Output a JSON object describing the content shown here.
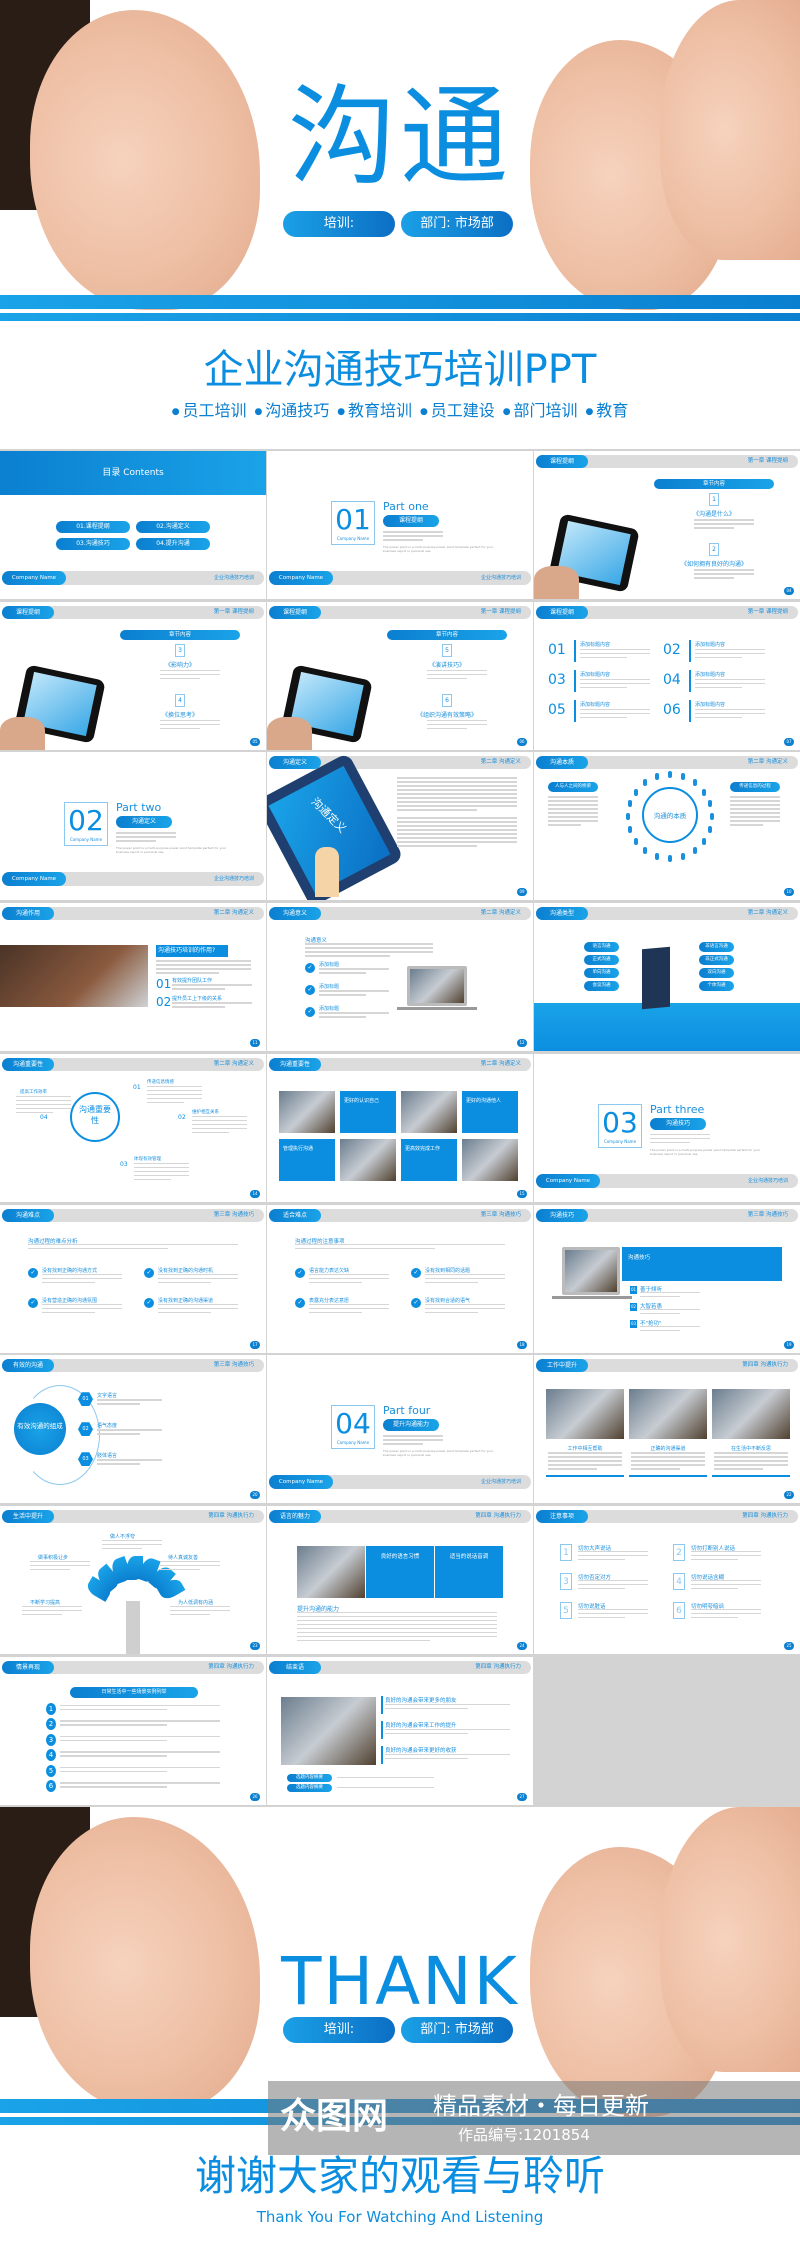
{
  "cover": {
    "title": "沟通",
    "pill_training": "培训:",
    "pill_dept": "部门: 市场部",
    "subtitle": "企业沟通技巧培训PPT",
    "tags": [
      "员工培训",
      "沟通技巧",
      "教育培训",
      "员工建设",
      "部门培训",
      "教育"
    ]
  },
  "colors": {
    "accent": "#0b8ee0",
    "accent_dark": "#0b7fd0",
    "grid_bg": "#d3d3d3"
  },
  "slides": [
    {
      "type": "contents",
      "title": "目录 Contents",
      "items": [
        "01.课程提纲",
        "02.沟通定义",
        "03.沟通技巧",
        "04.提升沟通"
      ],
      "company": "Company Name",
      "footer": "企业沟通技巧培训"
    },
    {
      "type": "part",
      "num": "01",
      "part": "Part one",
      "label": "课程提纲",
      "company": "Company Name",
      "footer": "企业沟通技巧培训",
      "text": "The power point is a multi-purpose power point template perfect for your business report or personal use."
    },
    {
      "type": "chapter",
      "tag": "课程提纲",
      "sec": "第一章 课程提纲",
      "head": "章节内容",
      "items": [
        {
          "n": "1",
          "t": "《沟通是什么》"
        },
        {
          "n": "2",
          "t": "《如何拥有良好的沟通》"
        }
      ],
      "page": "04"
    },
    {
      "type": "chapter",
      "tag": "课程提纲",
      "sec": "第一章 课程提纲",
      "head": "章节内容",
      "items": [
        {
          "n": "3",
          "t": "《影响力》"
        },
        {
          "n": "4",
          "t": "《换位思考》"
        }
      ],
      "page": "05"
    },
    {
      "type": "chapter",
      "tag": "课程提纲",
      "sec": "第一章 课程提纲",
      "head": "章节内容",
      "items": [
        {
          "n": "5",
          "t": "《演讲技巧》"
        },
        {
          "n": "6",
          "t": "《组织沟通有效策略》"
        }
      ],
      "page": "06"
    },
    {
      "type": "sixlist",
      "tag": "课程提纲",
      "sec": "第一章 课程提纲",
      "items": [
        "01",
        "02",
        "03",
        "04",
        "05",
        "06"
      ],
      "label": "添加标题内容",
      "page": "07"
    },
    {
      "type": "part",
      "num": "02",
      "part": "Part two",
      "label": "沟通定义",
      "company": "Company Name",
      "footer": "企业沟通技巧培训",
      "text": "The power point is a multi-purpose power point template perfect for your business report or personal use."
    },
    {
      "type": "tabletdef",
      "tag": "沟通定义",
      "sec": "第二章 沟通定义",
      "screen": "沟通定义",
      "page": "09"
    },
    {
      "type": "essence",
      "tag": "沟通本质",
      "sec": "第二章 沟通定义",
      "center": "沟通的本质",
      "left": "人与人之间的桥梁",
      "right": "传递信息的过程",
      "page": "10"
    },
    {
      "type": "role",
      "tag": "沟通作用",
      "sec": "第二章 沟通定义",
      "head": "沟通技巧培训的作用?",
      "items": [
        {
          "n": "01",
          "t": "有效提升团队工作"
        },
        {
          "n": "02",
          "t": "提升员工上下级的关系"
        }
      ],
      "page": "11"
    },
    {
      "type": "meaning",
      "tag": "沟通意义",
      "sec": "第二章 沟通定义",
      "head": "沟通意义",
      "items": [
        "添加标题",
        "添加标题",
        "添加标题"
      ],
      "page": "12"
    },
    {
      "type": "kinds",
      "tag": "沟通类型",
      "sec": "第二章 沟通定义",
      "left": [
        "语言沟通",
        "正式沟通",
        "单向沟通",
        "会议沟通"
      ],
      "right": [
        "非语言沟通",
        "非正式沟通",
        "双向沟通",
        "个体沟通"
      ],
      "page": "13"
    },
    {
      "type": "importance",
      "tag": "沟通重要性",
      "sec": "第二章 沟通定义",
      "center": "沟通重要性",
      "items": [
        {
          "n": "01",
          "t": "传递信息情感"
        },
        {
          "n": "02",
          "t": "维护相互关系"
        },
        {
          "n": "03",
          "t": "体现有效管理"
        },
        {
          "n": "04",
          "t": "提高工作效率"
        }
      ],
      "page": "14"
    },
    {
      "type": "photogrid",
      "tag": "沟通重要性",
      "sec": "第二章 沟通定义",
      "items": [
        "更好的认识自己",
        "更好的沟通他人",
        "管理执行沟通",
        "更高效完成工作"
      ],
      "page": "15"
    },
    {
      "type": "part",
      "num": "03",
      "part": "Part three",
      "label": "沟通技巧",
      "company": "Company Name",
      "footer": "企业沟通技巧培训",
      "text": "The power point is a multi-purpose power point template perfect for your business report or personal use."
    },
    {
      "type": "checks",
      "tag": "沟通难点",
      "sec": "第三章 沟通技巧",
      "head": "沟通过程的难点分析",
      "items": [
        "没有找到正确的沟通方式",
        "没有找到正确的沟通时机",
        "没有营造正确的沟通氛围",
        "没有找到正确的沟通渠道"
      ],
      "page": "17"
    },
    {
      "type": "checks",
      "tag": "适合难点",
      "sec": "第三章 沟通技巧",
      "head": "沟通过程的注意事项",
      "items": [
        "语言能力表达欠缺",
        "没有找到相同的话题",
        "表露充分表达意愿",
        "没有找到合适的语气"
      ],
      "page": "18"
    },
    {
      "type": "skills",
      "tag": "沟通技巧",
      "sec": "第三章 沟通技巧",
      "head": "沟通技巧",
      "items": [
        {
          "n": "01",
          "t": "善于倾听"
        },
        {
          "n": "02",
          "t": "大智若愚"
        },
        {
          "n": "03",
          "t": "不\"抢功\""
        }
      ],
      "page": "19"
    },
    {
      "type": "effective",
      "tag": "有效的沟通",
      "sec": "第三章 沟通技巧",
      "center": "有效沟通的组成",
      "items": [
        {
          "n": "01",
          "t": "文字语言"
        },
        {
          "n": "02",
          "t": "语气态度"
        },
        {
          "n": "03",
          "t": "肢体语言"
        }
      ],
      "page": "20"
    },
    {
      "type": "part",
      "num": "04",
      "part": "Part four",
      "label": "提升沟通能力",
      "company": "Company Name",
      "footer": "企业沟通技巧培训",
      "text": "The power point is a multi-purpose power point template perfect for your business report or personal use."
    },
    {
      "type": "threephotos",
      "tag": "工作中提升",
      "sec": "第四章 沟通执行力",
      "items": [
        "工作中相互帮助",
        "正确的沟通渠道",
        "在生活中不断反思"
      ],
      "page": "22"
    },
    {
      "type": "tree",
      "tag": "生活中提升",
      "sec": "第四章 沟通执行力",
      "items": [
        "做人不浮夸",
        "做事积极让步",
        "待人真诚友善",
        "不断学习提高",
        "为人低调有内涵"
      ],
      "page": "23"
    },
    {
      "type": "language",
      "tag": "语言的魅力",
      "sec": "第四章 沟通执行力",
      "boxes": [
        "良好的语言习惯",
        "适当的说话音调"
      ],
      "head": "提升沟通的能力",
      "page": "24"
    },
    {
      "type": "notes",
      "tag": "注意事项",
      "sec": "第四章 沟通执行力",
      "items": [
        {
          "n": "1",
          "t": "切勿大声说话"
        },
        {
          "n": "2",
          "t": "切勿打断别人说话"
        },
        {
          "n": "3",
          "t": "切勿否定对方"
        },
        {
          "n": "4",
          "t": "切勿说话含糊"
        },
        {
          "n": "5",
          "t": "切勿说脏话"
        },
        {
          "n": "6",
          "t": "切勿明夸暗讽"
        }
      ],
      "page": "25"
    },
    {
      "type": "scenes",
      "tag": "情景再现",
      "sec": "第四章 沟通执行力",
      "head": "日常生活中一些场景实例列举",
      "items": [
        "1",
        "2",
        "3",
        "4",
        "5",
        "6"
      ],
      "page": "26"
    },
    {
      "type": "ending",
      "tag": "结束语",
      "sec": "第四章 沟通执行力",
      "items": [
        "良好的沟通会带来更多的朋友",
        "良好的沟通会带来工作的提升",
        "良好的沟通会带来更好的收获"
      ],
      "btns": [
        "选题内容摘要",
        "选题内容摘要"
      ],
      "page": "27"
    }
  ],
  "closing": {
    "title": "THANK",
    "pill_training": "培训:",
    "pill_dept": "部门: 市场部",
    "subtitle": "谢谢大家的观看与聆听",
    "subtitle_en": "Thank You For Watching And Listening"
  },
  "watermark": {
    "logo": "众图网",
    "slogan": "精品素材・每日更新",
    "id": "作品编号:1201854"
  }
}
